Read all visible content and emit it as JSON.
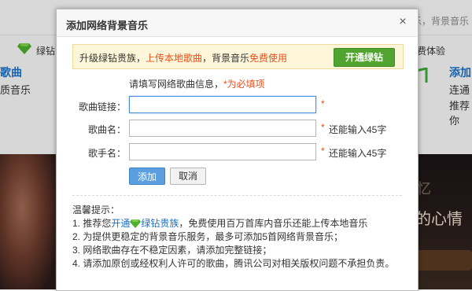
{
  "background": {
    "top_right_text": "乐，背景音乐",
    "left_green_text": "绿钻",
    "left_blue_text": "歌曲",
    "left_text": "质音乐",
    "right_exp_text": "费体验",
    "right_add_text": "添加",
    "right_line1": "连通",
    "right_line2": "推荐你",
    "photo_text1": "忆",
    "photo_text2": "的心情"
  },
  "dialog": {
    "title": "添加网络背景音乐",
    "close_glyph": "×",
    "promo": {
      "prefix": "升级绿钻贵族，",
      "highlight1": "上传本地歌曲",
      "middle": "，背景音乐",
      "highlight2": "免费使用",
      "button": "开通绿钻"
    },
    "hint_prefix": "请填写网络歌曲信息，",
    "hint_req": "*为必填项",
    "fields": {
      "link_label": "歌曲链接：",
      "song_label": "歌曲名：",
      "singer_label": "歌手名：",
      "link_value": "",
      "song_value": "",
      "singer_value": "",
      "required_mark": "*",
      "song_remain": "还能输入45字",
      "singer_remain": "还能输入45字"
    },
    "add_button": "添加",
    "cancel_button": "取消",
    "tips": {
      "title": "温馨提示：",
      "tip1_prefix": "1. 推荐您",
      "tip1_link1": "开通",
      "tip1_link2": "绿钻贵族",
      "tip1_suffix": "，免费使用百万首库内音乐还能上传本地音乐",
      "tip2": "2. 为提供更稳定的背景音乐服务，最多可添加5首网络背景音乐；",
      "tip3": "3. 网络歌曲存在不稳定因素，请添加完整链接；",
      "tip4": "4. 请添加原创或经权利人许可的歌曲，腾讯公司对相关版权问题不承担负责。"
    }
  },
  "colors": {
    "accent_green": "#52a431",
    "highlight_orange": "#e8511f",
    "link_blue": "#1a6fc6",
    "add_button_blue": "#5b9fe0"
  }
}
